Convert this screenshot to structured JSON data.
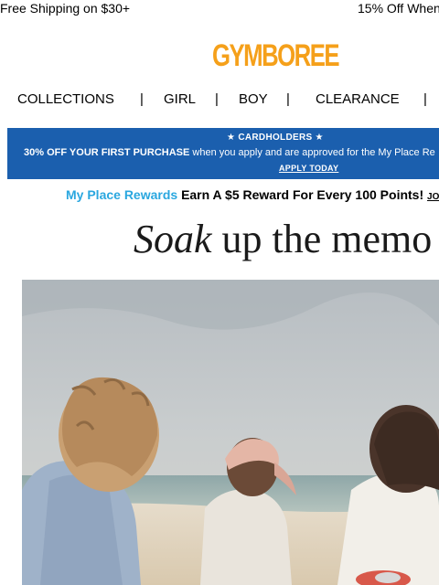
{
  "promo": {
    "left_text": "Free Shipping on $30+",
    "right_text": "15% Off When"
  },
  "logo": {
    "text": "GYMBOREE",
    "color": "#f5a01a"
  },
  "nav": {
    "separator": "|",
    "items": [
      "COLLECTIONS",
      "GIRL",
      "BOY",
      "CLEARANCE"
    ]
  },
  "banner": {
    "cardholders": "CARDHOLDERS",
    "offer_bold": "30% OFF YOUR FIRST PURCHASE",
    "offer_rest": "when you apply and are approved for the My Place Re",
    "cta": "APPLY TODAY",
    "bg_color": "#1b5fae"
  },
  "rewards": {
    "program_name": "My Place Rewards",
    "message": "Earn A $5 Reward For Every 100 Points!",
    "link": "JO",
    "accent_color": "#2aa7df"
  },
  "hero": {
    "headline_italic": "Soak",
    "headline_rest": "up the memo",
    "image_icon": "beach-kids-photo"
  }
}
